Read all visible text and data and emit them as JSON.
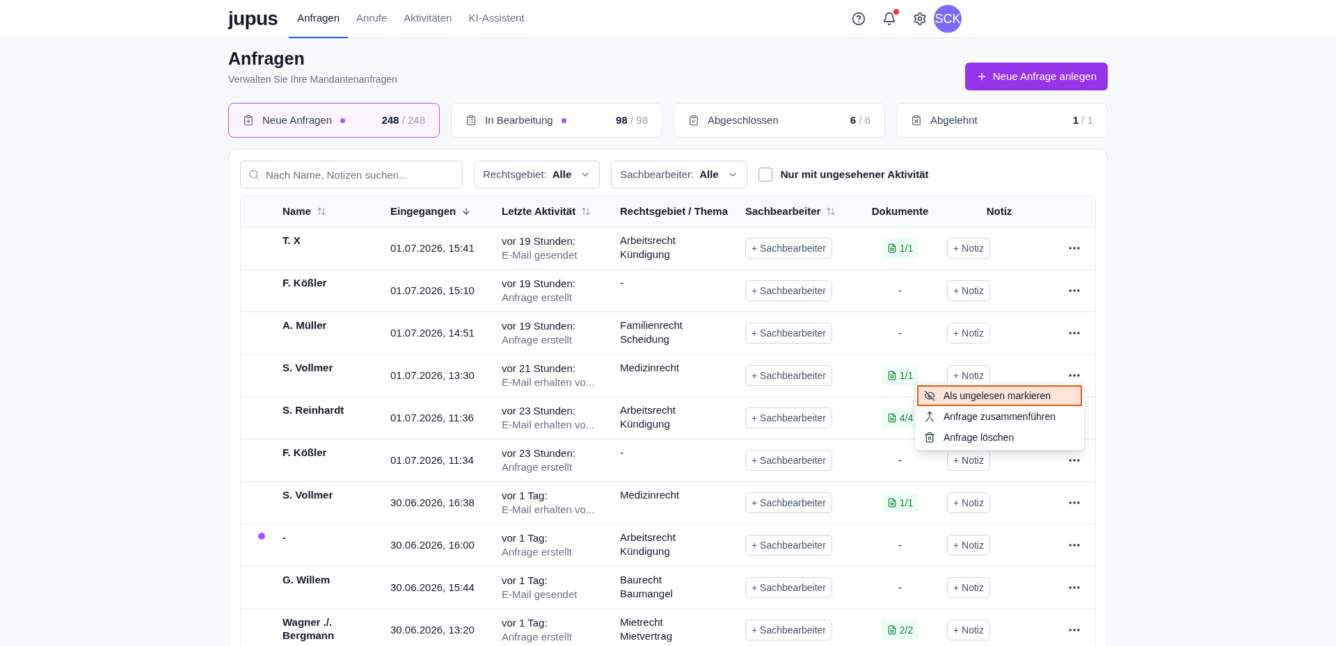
{
  "nav": {
    "logo": "jupus",
    "tabs": [
      {
        "label": "Anfragen",
        "selected": true
      },
      {
        "label": "Anrufe",
        "selected": false
      },
      {
        "label": "Aktivitäten",
        "selected": false
      },
      {
        "label": "KI-Assistent",
        "selected": false
      }
    ],
    "notification_unread": true,
    "avatar": "SCK"
  },
  "page": {
    "title": "Anfragen",
    "subtitle": "Verwalten Sie Ihre Mandantenanfragen",
    "create_button": "Neue Anfrage anlegen"
  },
  "stats": [
    {
      "kind": "new",
      "label": "Neue Anfragen",
      "dot": true,
      "count": "248",
      "total": "/ 248",
      "selected": true
    },
    {
      "kind": "progress",
      "label": "In Bearbeitung",
      "dot": true,
      "count": "98",
      "total": "/ 98",
      "selected": false
    },
    {
      "kind": "done",
      "label": "Abgeschlossen",
      "dot": false,
      "count": "6",
      "total": "/ 6",
      "selected": false
    },
    {
      "kind": "rejected",
      "label": "Abgelehnt",
      "dot": false,
      "count": "1",
      "total": "/ 1",
      "selected": false
    }
  ],
  "filters": {
    "search": {
      "placeholder": "Nach Name, Notizen suchen..."
    },
    "dropdowns": [
      {
        "label": "Rechtsgebiet:",
        "value": "Alle"
      },
      {
        "label": "Sachbearbeiter:",
        "value": "Alle"
      }
    ],
    "unseen_only": {
      "label": "Nur mit ungesehener Aktivität",
      "checked": false
    }
  },
  "table": {
    "columns": [
      {
        "label": "Name",
        "kind": "sortable"
      },
      {
        "label": "Eingegangen",
        "kind": "sorted"
      },
      {
        "label": "Letzte Aktivität",
        "kind": "sortable"
      },
      {
        "label": "Rechtsgebiet / Thema",
        "kind": "plain"
      },
      {
        "label": "Sachbearbeiter",
        "kind": "sortable"
      },
      {
        "label": "Dokumente",
        "kind": "plain"
      },
      {
        "label": "Notiz",
        "kind": "plain"
      }
    ],
    "rows": [
      {
        "unread": false,
        "name": "T. X",
        "received": "01.07.2026, 15:41",
        "activity_time": "vor 19 Stunden:",
        "activity": "E-Mail gesendet",
        "topic": [
          "Arbeitsrecht",
          "Kündigung"
        ],
        "documents": "1/1",
        "assignee": "+ Sachbearbeiter",
        "note": "+ Notiz"
      },
      {
        "unread": false,
        "name": "F. Kößler",
        "received": "01.07.2026, 15:10",
        "activity_time": "vor 19 Stunden:",
        "activity": "Anfrage erstellt",
        "topic": [
          "-"
        ],
        "documents": "-",
        "assignee": "+ Sachbearbeiter",
        "note": "+ Notiz"
      },
      {
        "unread": false,
        "name": "A. Müller",
        "received": "01.07.2026, 14:51",
        "activity_time": "vor 19 Stunden:",
        "activity": "Anfrage erstellt",
        "topic": [
          "Familienrecht",
          "Scheidung"
        ],
        "documents": "-",
        "assignee": "+ Sachbearbeiter",
        "note": "+ Notiz"
      },
      {
        "unread": false,
        "name": "S. Vollmer",
        "received": "01.07.2026, 13:30",
        "activity_time": "vor 21 Stunden:",
        "activity": "E-Mail erhalten vo...",
        "topic": [
          "Medizinrecht"
        ],
        "documents": "1/1",
        "assignee": "+ Sachbearbeiter",
        "note": "+ Notiz",
        "menu": [
          {
            "kind": "unread",
            "label": "Als ungelesen markieren",
            "selected": true
          },
          {
            "kind": "merge",
            "label": "Anfrage zusammenführen",
            "selected": false
          },
          {
            "kind": "delete",
            "label": "Anfrage löschen",
            "selected": false
          }
        ]
      },
      {
        "unread": false,
        "name": "S. Reinhardt",
        "received": "01.07.2026, 11:36",
        "activity_time": "vor 23 Stunden:",
        "activity": "E-Mail erhalten vo...",
        "topic": [
          "Arbeitsrecht",
          "Kündigung"
        ],
        "documents": "4/4",
        "assignee": "+ Sachbearbeiter"
      },
      {
        "unread": false,
        "name": "F. Kößler",
        "received": "01.07.2026, 11:34",
        "activity_time": "vor 23 Stunden:",
        "activity": "Anfrage erstellt",
        "topic": [
          "-"
        ],
        "documents": "-",
        "assignee": "+ Sachbearbeiter",
        "note": "+ Notiz"
      },
      {
        "unread": false,
        "name": "S. Vollmer",
        "received": "30.06.2026, 16:38",
        "activity_time": "vor 1 Tag:",
        "activity": "E-Mail erhalten vo...",
        "topic": [
          "Medizinrecht"
        ],
        "documents": "1/1",
        "assignee": "+ Sachbearbeiter",
        "note": "+ Notiz"
      },
      {
        "unread": true,
        "name": "-",
        "received": "30.06.2026, 16:00",
        "activity_time": "vor 1 Tag:",
        "activity": "Anfrage erstellt",
        "topic": [
          "Arbeitsrecht",
          "Kündigung"
        ],
        "documents": "-",
        "assignee": "+ Sachbearbeiter",
        "note": "+ Notiz"
      },
      {
        "unread": false,
        "name": "G. Willem",
        "received": "30.06.2026, 15:44",
        "activity_time": "vor 1 Tag:",
        "activity": "E-Mail gesendet",
        "topic": [
          "Baurecht",
          "Baumangel"
        ],
        "documents": "-",
        "assignee": "+ Sachbearbeiter",
        "note": "+ Notiz"
      },
      {
        "unread": false,
        "name": "Wagner ./. Bergmann",
        "received": "30.06.2026, 13:20",
        "activity_time": "vor 1 Tag:",
        "activity": "Anfrage erstellt",
        "topic": [
          "Mietrecht",
          "Mietvertrag"
        ],
        "documents": "2/2",
        "assignee": "+ Sachbearbeiter",
        "note": "+ Notiz"
      }
    ]
  }
}
